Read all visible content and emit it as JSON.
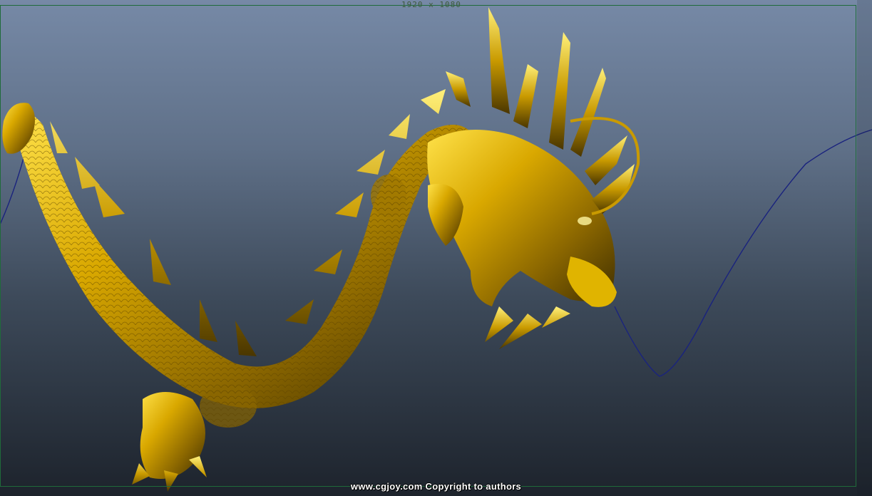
{
  "viewport": {
    "resolution_label": "1920 x 1080",
    "watermark": "www.cgjoy.com Copyright to authors"
  },
  "colors": {
    "gold_light": "#ffe24a",
    "gold_mid": "#c99a00",
    "gold_dark": "#5a4200",
    "curve": "#1a237e",
    "gate_border": "#1f6b3a"
  }
}
